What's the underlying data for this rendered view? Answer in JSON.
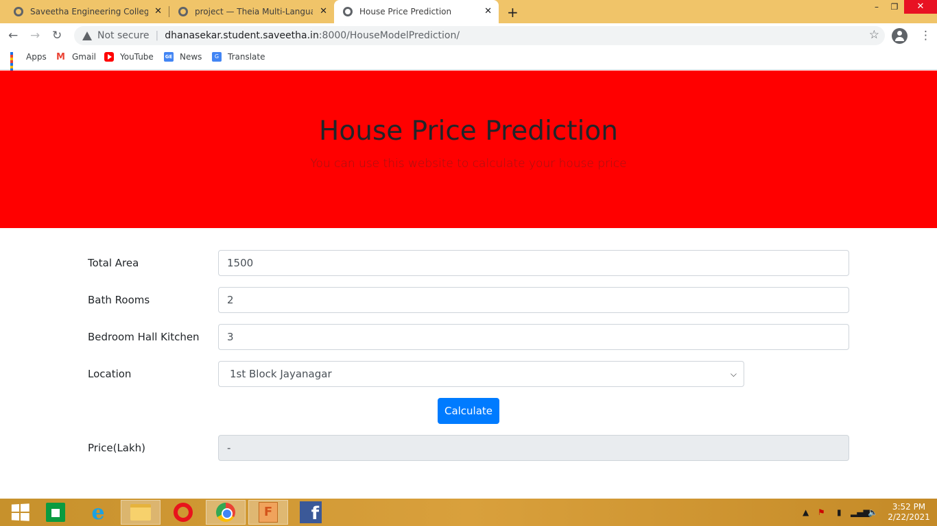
{
  "browser": {
    "tabs": [
      {
        "title": "Saveetha Engineering College",
        "active": false
      },
      {
        "title": "project — Theia Multi-Language",
        "active": false
      },
      {
        "title": "House Price Prediction",
        "active": true
      }
    ],
    "new_tab_label": "+",
    "window_controls": {
      "minimize": "–",
      "maximize": "❐",
      "close": "✕"
    },
    "nav": {
      "back": "←",
      "forward": "→",
      "reload": "↻"
    },
    "security_label": "Not secure",
    "url_host": "dhanasekar.student.saveetha.in",
    "url_rest": ":8000/HouseModelPrediction/",
    "bookmark_star": "☆",
    "menu_icon": "⋮",
    "bookmarks": [
      {
        "label": "Apps",
        "icon": "apps-icon"
      },
      {
        "label": "Gmail",
        "icon": "gmail-icon"
      },
      {
        "label": "YouTube",
        "icon": "youtube-icon"
      },
      {
        "label": "News",
        "icon": "news-icon"
      },
      {
        "label": "Translate",
        "icon": "translate-icon"
      }
    ]
  },
  "page": {
    "title": "House Price Prediction",
    "subtitle": "You can use this website to calculate your house price",
    "hero_color": "#ff0000",
    "form": {
      "total_area_label": "Total Area",
      "total_area_value": "1500",
      "bath_rooms_label": "Bath Rooms",
      "bath_rooms_value": "2",
      "bhk_label": "Bedroom Hall Kitchen",
      "bhk_value": "3",
      "location_label": "Location",
      "location_value": "1st Block Jayanagar",
      "calculate_label": "Calculate",
      "price_label": "Price(Lakh)",
      "price_value": "-"
    },
    "button_color": "#007bff"
  },
  "taskbar": {
    "time": "3:52 PM",
    "date": "2/22/2021",
    "apps": [
      "start-icon",
      "store-icon",
      "internet-explorer-icon",
      "file-explorer-icon",
      "opera-icon",
      "chrome-icon",
      "app-f-icon",
      "facebook-icon"
    ]
  }
}
